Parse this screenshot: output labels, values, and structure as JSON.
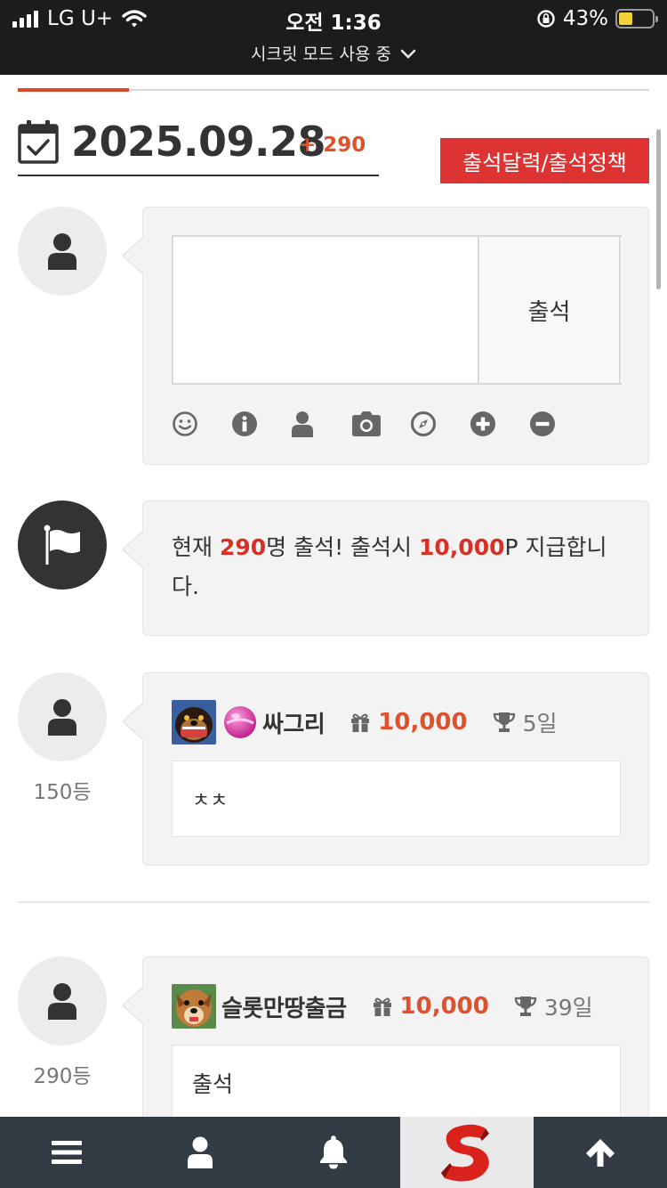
{
  "status_bar": {
    "carrier": "LG U+",
    "time": "오전 1:36",
    "battery_percent": "43%",
    "battery_level": 0.43,
    "mode_label": "시크릿 모드 사용 중"
  },
  "header": {
    "date": "2025.09.28",
    "count": "+ 290",
    "policy_button": "출석달력/출석정책"
  },
  "write_form": {
    "input_value": "",
    "attend_button": "출석",
    "tools": [
      "smile-icon",
      "info-icon",
      "user-icon",
      "camera-icon",
      "compass-icon",
      "plus-circle-icon",
      "minus-circle-icon"
    ]
  },
  "notice": {
    "prefix": "현재 ",
    "count": "290",
    "mid": "명 출석! 출석시 ",
    "points": "10,000",
    "suffix": "P 지급합니다."
  },
  "entries": [
    {
      "rank": "150등",
      "name": "싸그리",
      "points": "10,000",
      "days": "5일",
      "message": "ㅊㅊ"
    },
    {
      "rank": "290등",
      "name": "슬롯만땅출금",
      "points": "10,000",
      "days": "39일",
      "message": "출석"
    }
  ],
  "bottom_nav": {
    "items": [
      "menu-icon",
      "user-icon",
      "bell-icon",
      "site-logo",
      "arrow-up-icon"
    ]
  },
  "colors": {
    "accent": "#e0502b",
    "button_red": "#dd3333",
    "nav_bg": "#333b44"
  }
}
